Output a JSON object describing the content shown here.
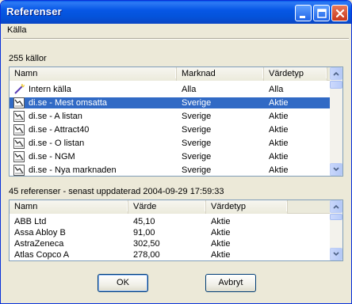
{
  "window": {
    "title": "Referenser"
  },
  "menu": {
    "kalla": "Källa"
  },
  "sources": {
    "count_label": "255 källor",
    "columns": [
      "Namn",
      "Marknad",
      "Värdetyp"
    ],
    "rows": [
      {
        "icon": "wand-icon",
        "name": "Intern källa",
        "market": "Alla",
        "type": "Alla"
      },
      {
        "icon": "chart-icon",
        "name": "di.se - Mest omsatta",
        "market": "Sverige",
        "type": "Aktie",
        "selected": true
      },
      {
        "icon": "chart-icon",
        "name": "di.se - A listan",
        "market": "Sverige",
        "type": "Aktie"
      },
      {
        "icon": "chart-icon",
        "name": "di.se - Attract40",
        "market": "Sverige",
        "type": "Aktie"
      },
      {
        "icon": "chart-icon",
        "name": "di.se - O listan",
        "market": "Sverige",
        "type": "Aktie"
      },
      {
        "icon": "chart-icon",
        "name": "di.se - NGM",
        "market": "Sverige",
        "type": "Aktie"
      },
      {
        "icon": "chart-icon",
        "name": "di.se - Nya marknaden",
        "market": "Sverige",
        "type": "Aktie"
      }
    ]
  },
  "references": {
    "status_label": "45 referenser - senast uppdaterad 2004-09-29 17:59:33",
    "columns": [
      "Namn",
      "Värde",
      "Värdetyp"
    ],
    "rows": [
      {
        "name": "ABB Ltd",
        "value": "45,10",
        "type": "Aktie"
      },
      {
        "name": "Assa Abloy B",
        "value": "91,00",
        "type": "Aktie"
      },
      {
        "name": "AstraZeneca",
        "value": "302,50",
        "type": "Aktie"
      },
      {
        "name": "Atlas Copco A",
        "value": "278,00",
        "type": "Aktie"
      }
    ]
  },
  "buttons": {
    "ok": "OK",
    "cancel": "Avbryt"
  }
}
